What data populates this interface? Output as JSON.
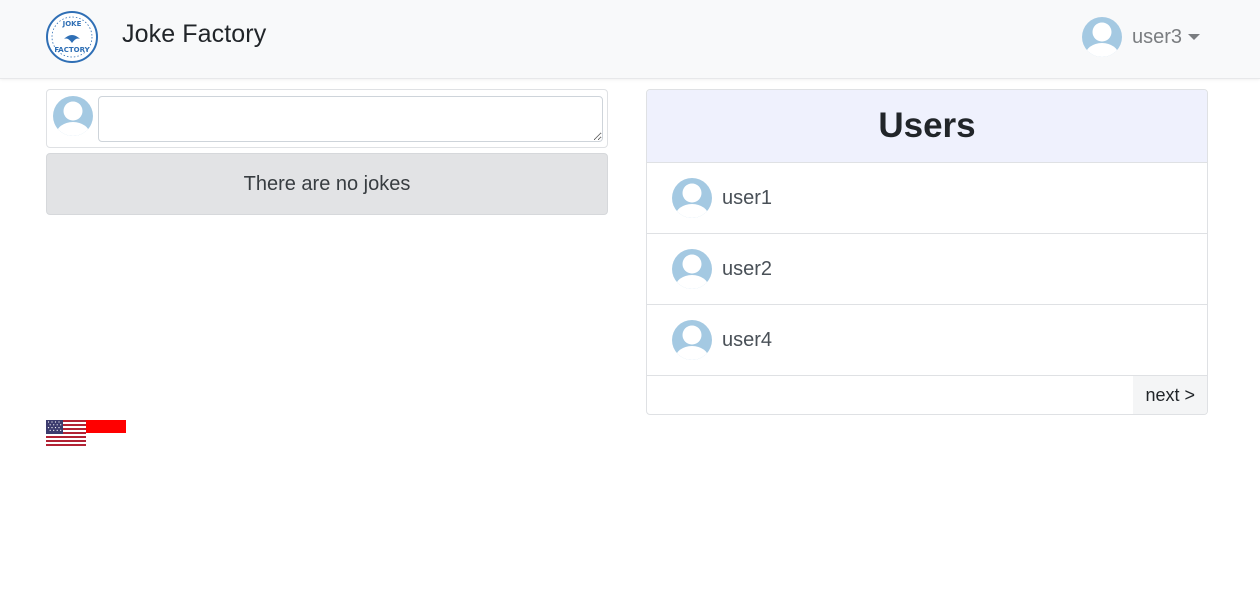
{
  "navbar": {
    "brand": "Joke Factory",
    "logo_text_top": "JOKE",
    "logo_text_bottom": "FACTORY",
    "current_user": "user3"
  },
  "composer": {
    "placeholder": "",
    "value": ""
  },
  "jokes": {
    "empty_message": "There are no jokes"
  },
  "languages": [
    {
      "name": "us-flag-icon"
    },
    {
      "name": "indonesia-flag-icon"
    }
  ],
  "users_panel": {
    "title": "Users",
    "users": [
      {
        "username": "user1"
      },
      {
        "username": "user2"
      },
      {
        "username": "user4"
      }
    ],
    "next_label": "next >"
  },
  "colors": {
    "navbar_bg": "#f8f9fa",
    "avatar_bg": "#a4c9e2",
    "users_header_bg": "#eff1fd",
    "alert_bg": "#e2e3e5",
    "logo_blue": "#2f6fb5"
  }
}
